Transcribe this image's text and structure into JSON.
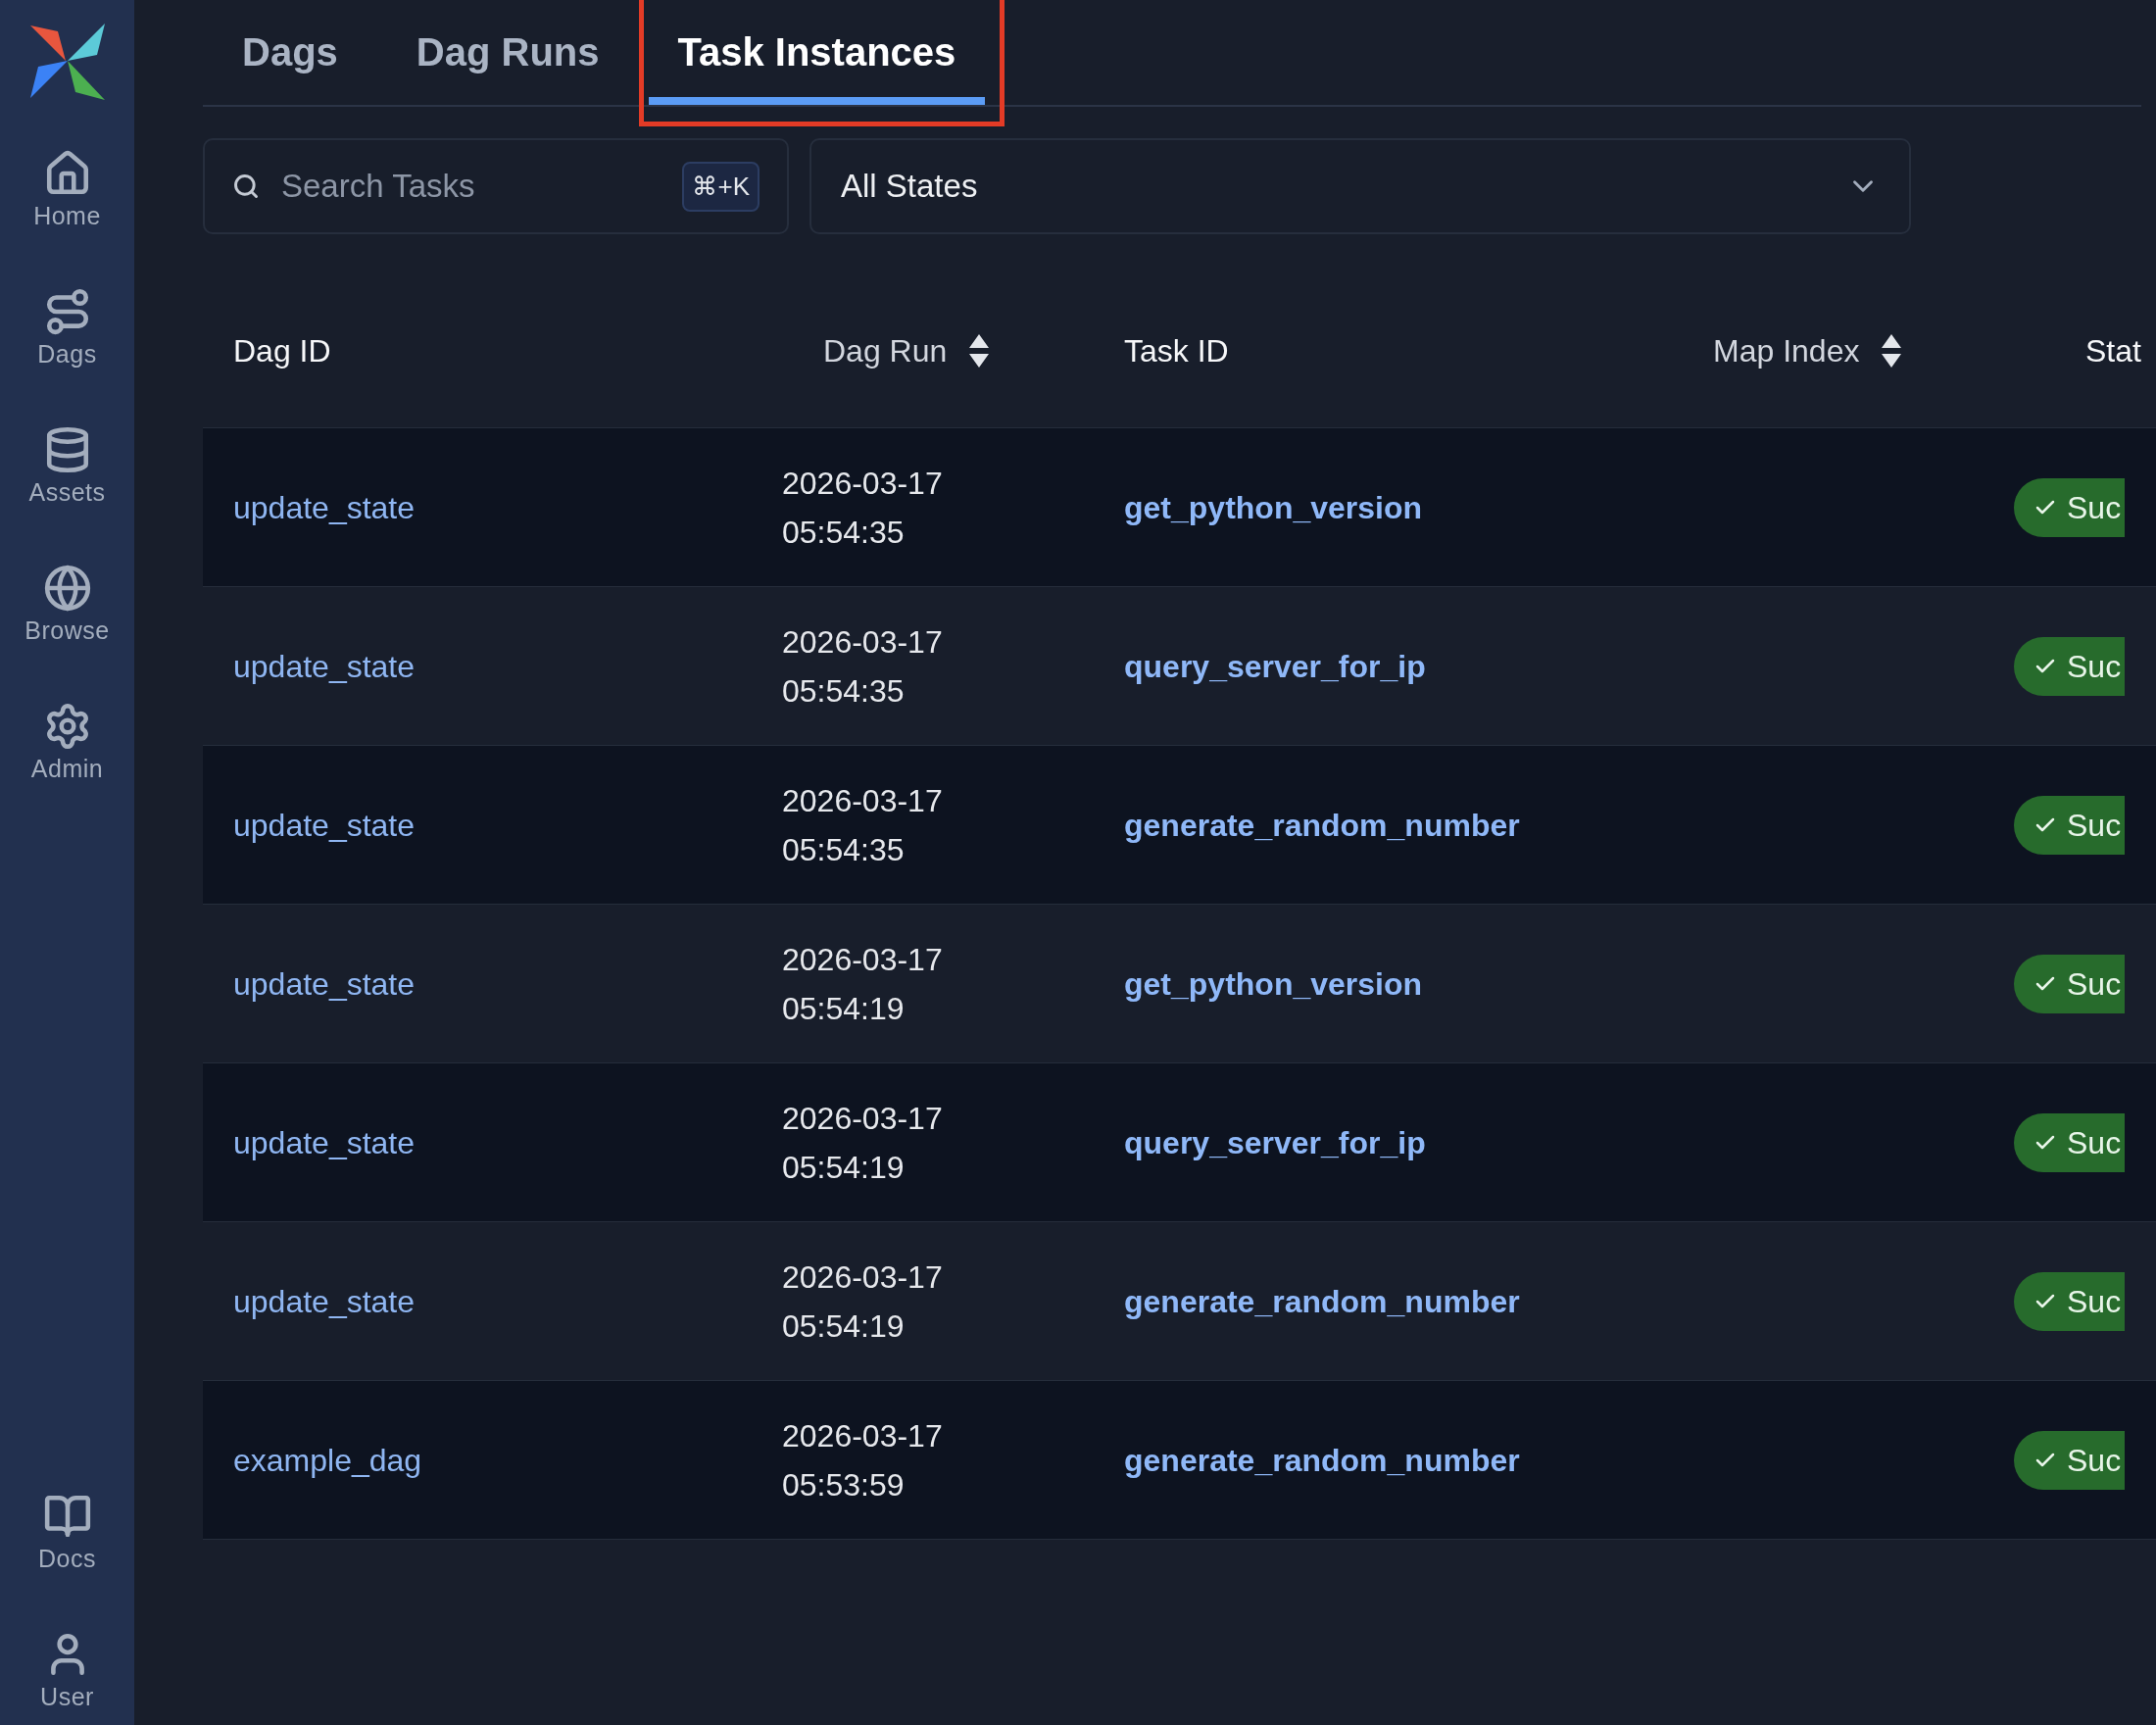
{
  "sidebar": {
    "items": [
      {
        "label": "Home"
      },
      {
        "label": "Dags"
      },
      {
        "label": "Assets"
      },
      {
        "label": "Browse"
      },
      {
        "label": "Admin"
      }
    ],
    "bottom_items": [
      {
        "label": "Docs"
      },
      {
        "label": "User"
      }
    ]
  },
  "tabs": [
    {
      "label": "Dags",
      "selected": false
    },
    {
      "label": "Dag Runs",
      "selected": false
    },
    {
      "label": "Task Instances",
      "selected": true
    }
  ],
  "search": {
    "placeholder": "Search Tasks",
    "shortcut": "⌘+K"
  },
  "state_filter": {
    "value": "All States"
  },
  "table": {
    "columns": [
      {
        "label": "Dag ID",
        "sortable": false
      },
      {
        "label": "Dag Run",
        "sortable": true
      },
      {
        "label": "Task ID",
        "sortable": false
      },
      {
        "label": "Map Index",
        "sortable": true
      },
      {
        "label": "Stat",
        "sortable": false
      }
    ],
    "rows": [
      {
        "dag_id": "update_state",
        "dag_run": "2026-03-17 05:54:35",
        "task_id": "get_python_version",
        "state": "Suc"
      },
      {
        "dag_id": "update_state",
        "dag_run": "2026-03-17 05:54:35",
        "task_id": "query_server_for_ip",
        "state": "Suc"
      },
      {
        "dag_id": "update_state",
        "dag_run": "2026-03-17 05:54:35",
        "task_id": "generate_random_number",
        "state": "Suc"
      },
      {
        "dag_id": "update_state",
        "dag_run": "2026-03-17 05:54:19",
        "task_id": "get_python_version",
        "state": "Suc"
      },
      {
        "dag_id": "update_state",
        "dag_run": "2026-03-17 05:54:19",
        "task_id": "query_server_for_ip",
        "state": "Suc"
      },
      {
        "dag_id": "update_state",
        "dag_run": "2026-03-17 05:54:19",
        "task_id": "generate_random_number",
        "state": "Suc"
      },
      {
        "dag_id": "example_dag",
        "dag_run": "2026-03-17 05:53:59",
        "task_id": "generate_random_number",
        "state": "Suc"
      }
    ]
  }
}
